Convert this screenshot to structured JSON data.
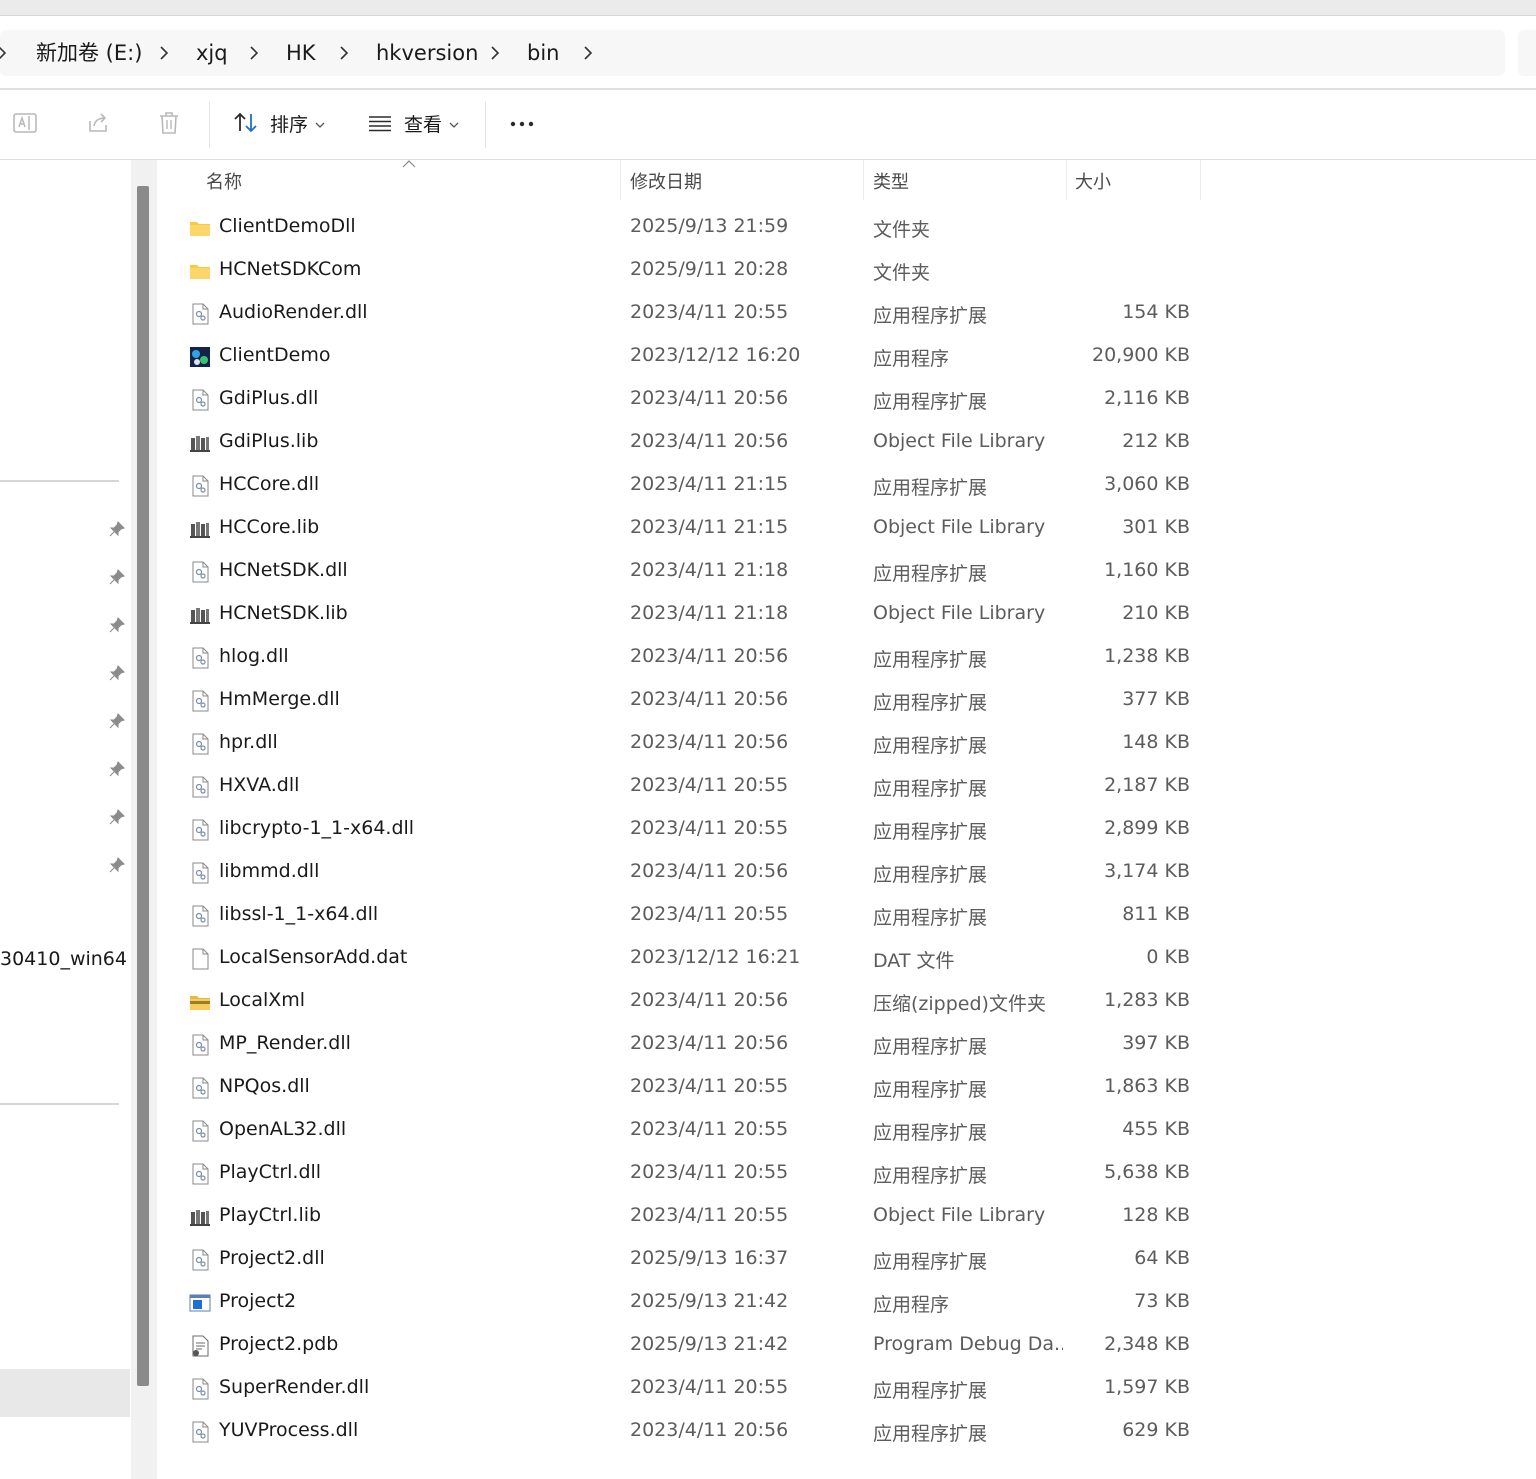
{
  "address": {
    "crumbs": [
      "新加卷 (E:)",
      "xjq",
      "HK",
      "hkversion",
      "bin"
    ]
  },
  "toolbar": {
    "sort_label": "排序",
    "view_label": "查看"
  },
  "sidebar": {
    "partial_item": "30410_win64"
  },
  "columns": {
    "name": "名称",
    "date": "修改日期",
    "type": "类型",
    "size": "大小"
  },
  "files": [
    {
      "name": "ClientDemoDll",
      "date": "2025/9/13 21:59",
      "type": "文件夹",
      "size": "",
      "icon": "folder-icon"
    },
    {
      "name": "HCNetSDKCom",
      "date": "2025/9/11 20:28",
      "type": "文件夹",
      "size": "",
      "icon": "folder-icon"
    },
    {
      "name": "AudioRender.dll",
      "date": "2023/4/11 20:55",
      "type": "应用程序扩展",
      "size": "154 KB",
      "icon": "dll-file-icon"
    },
    {
      "name": "ClientDemo",
      "date": "2023/12/12 16:20",
      "type": "应用程序",
      "size": "20,900 KB",
      "icon": "app-icon"
    },
    {
      "name": "GdiPlus.dll",
      "date": "2023/4/11 20:56",
      "type": "应用程序扩展",
      "size": "2,116 KB",
      "icon": "dll-file-icon"
    },
    {
      "name": "GdiPlus.lib",
      "date": "2023/4/11 20:56",
      "type": "Object File Library",
      "size": "212 KB",
      "icon": "lib-file-icon"
    },
    {
      "name": "HCCore.dll",
      "date": "2023/4/11 21:15",
      "type": "应用程序扩展",
      "size": "3,060 KB",
      "icon": "dll-file-icon"
    },
    {
      "name": "HCCore.lib",
      "date": "2023/4/11 21:15",
      "type": "Object File Library",
      "size": "301 KB",
      "icon": "lib-file-icon"
    },
    {
      "name": "HCNetSDK.dll",
      "date": "2023/4/11 21:18",
      "type": "应用程序扩展",
      "size": "1,160 KB",
      "icon": "dll-file-icon"
    },
    {
      "name": "HCNetSDK.lib",
      "date": "2023/4/11 21:18",
      "type": "Object File Library",
      "size": "210 KB",
      "icon": "lib-file-icon"
    },
    {
      "name": "hlog.dll",
      "date": "2023/4/11 20:56",
      "type": "应用程序扩展",
      "size": "1,238 KB",
      "icon": "dll-file-icon"
    },
    {
      "name": "HmMerge.dll",
      "date": "2023/4/11 20:56",
      "type": "应用程序扩展",
      "size": "377 KB",
      "icon": "dll-file-icon"
    },
    {
      "name": "hpr.dll",
      "date": "2023/4/11 20:56",
      "type": "应用程序扩展",
      "size": "148 KB",
      "icon": "dll-file-icon"
    },
    {
      "name": "HXVA.dll",
      "date": "2023/4/11 20:55",
      "type": "应用程序扩展",
      "size": "2,187 KB",
      "icon": "dll-file-icon"
    },
    {
      "name": "libcrypto-1_1-x64.dll",
      "date": "2023/4/11 20:55",
      "type": "应用程序扩展",
      "size": "2,899 KB",
      "icon": "dll-file-icon"
    },
    {
      "name": "libmmd.dll",
      "date": "2023/4/11 20:56",
      "type": "应用程序扩展",
      "size": "3,174 KB",
      "icon": "dll-file-icon"
    },
    {
      "name": "libssl-1_1-x64.dll",
      "date": "2023/4/11 20:55",
      "type": "应用程序扩展",
      "size": "811 KB",
      "icon": "dll-file-icon"
    },
    {
      "name": "LocalSensorAdd.dat",
      "date": "2023/12/12 16:21",
      "type": "DAT 文件",
      "size": "0 KB",
      "icon": "blank-file-icon"
    },
    {
      "name": "LocalXml",
      "date": "2023/4/11 20:56",
      "type": "压缩(zipped)文件夹",
      "size": "1,283 KB",
      "icon": "zip-folder-icon"
    },
    {
      "name": "MP_Render.dll",
      "date": "2023/4/11 20:56",
      "type": "应用程序扩展",
      "size": "397 KB",
      "icon": "dll-file-icon"
    },
    {
      "name": "NPQos.dll",
      "date": "2023/4/11 20:55",
      "type": "应用程序扩展",
      "size": "1,863 KB",
      "icon": "dll-file-icon"
    },
    {
      "name": "OpenAL32.dll",
      "date": "2023/4/11 20:55",
      "type": "应用程序扩展",
      "size": "455 KB",
      "icon": "dll-file-icon"
    },
    {
      "name": "PlayCtrl.dll",
      "date": "2023/4/11 20:55",
      "type": "应用程序扩展",
      "size": "5,638 KB",
      "icon": "dll-file-icon"
    },
    {
      "name": "PlayCtrl.lib",
      "date": "2023/4/11 20:55",
      "type": "Object File Library",
      "size": "128 KB",
      "icon": "lib-file-icon"
    },
    {
      "name": "Project2.dll",
      "date": "2025/9/13 16:37",
      "type": "应用程序扩展",
      "size": "64 KB",
      "icon": "dll-file-icon"
    },
    {
      "name": "Project2",
      "date": "2025/9/13 21:42",
      "type": "应用程序",
      "size": "73 KB",
      "icon": "exe-icon"
    },
    {
      "name": "Project2.pdb",
      "date": "2025/9/13 21:42",
      "type": "Program Debug Da...",
      "size": "2,348 KB",
      "icon": "pdb-file-icon"
    },
    {
      "name": "SuperRender.dll",
      "date": "2023/4/11 20:55",
      "type": "应用程序扩展",
      "size": "1,597 KB",
      "icon": "dll-file-icon"
    },
    {
      "name": "YUVProcess.dll",
      "date": "2023/4/11 20:56",
      "type": "应用程序扩展",
      "size": "629 KB",
      "icon": "dll-file-icon"
    }
  ]
}
